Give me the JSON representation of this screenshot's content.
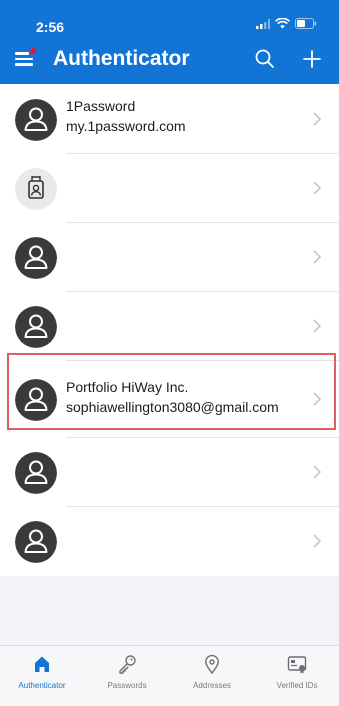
{
  "status_bar": {
    "time": "2:56"
  },
  "app_bar": {
    "title": "Authenticator",
    "menu_icon": "hamburger-icon",
    "search_icon": "search-icon",
    "add_icon": "plus-icon"
  },
  "accounts": [
    {
      "name": "1Password",
      "detail": "my.1password.com",
      "icon": "person-icon"
    },
    {
      "name": "",
      "detail": "",
      "icon": "badge-icon"
    },
    {
      "name": "",
      "detail": "",
      "icon": "person-icon"
    },
    {
      "name": "",
      "detail": "",
      "icon": "person-icon"
    },
    {
      "name": "Portfolio HiWay Inc.",
      "detail": "sophiawellington3080@gmail.com",
      "icon": "person-icon",
      "highlighted": true
    },
    {
      "name": "",
      "detail": "",
      "icon": "person-icon"
    },
    {
      "name": "",
      "detail": "",
      "icon": "person-icon"
    }
  ],
  "tabs": [
    {
      "label": "Authenticator",
      "icon": "home-icon",
      "active": true
    },
    {
      "label": "Passwords",
      "icon": "key-icon",
      "active": false
    },
    {
      "label": "Addresses",
      "icon": "location-pin-icon",
      "active": false
    },
    {
      "label": "Verified IDs",
      "icon": "id-card-icon",
      "active": false
    }
  ],
  "colors": {
    "brand": "#1275d6",
    "highlight_border": "#e05e5e",
    "notification_dot": "#e8192c"
  }
}
